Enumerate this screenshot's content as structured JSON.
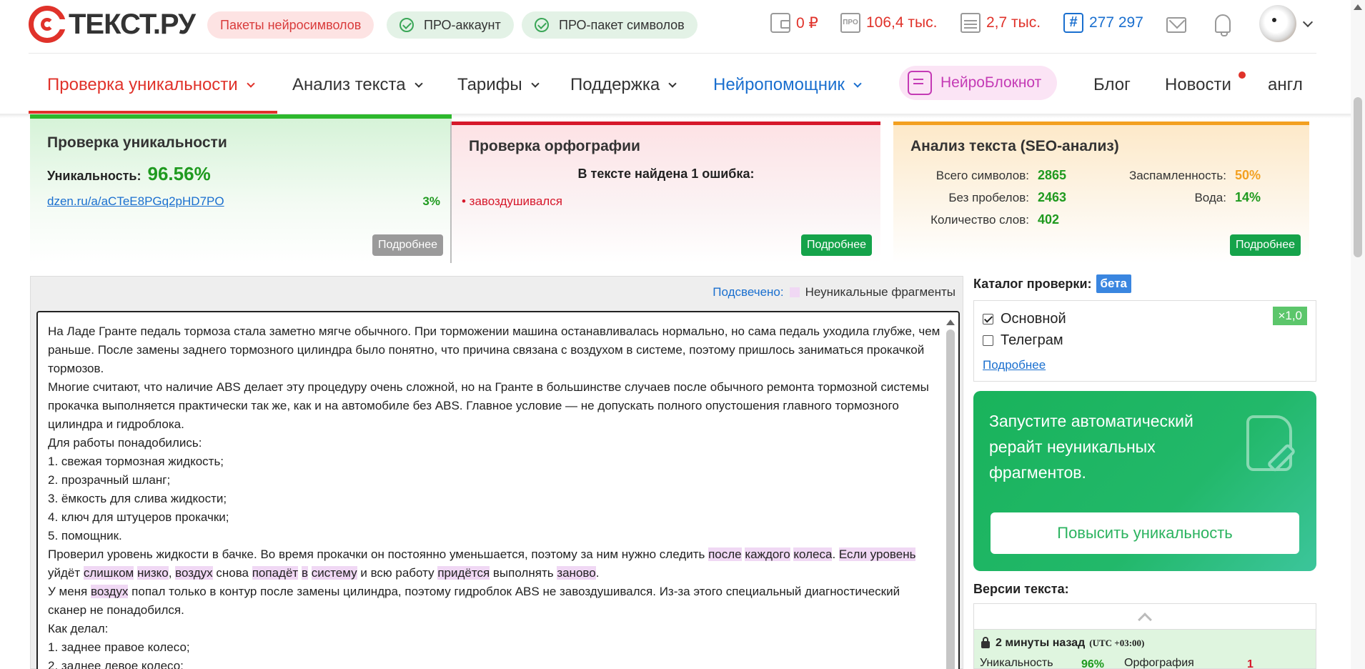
{
  "header": {
    "logo_text": "ТЕКСТ.РУ",
    "pills": {
      "neuro_packs": "Пакеты нейросимволов",
      "pro_account": "ПРО-аккаунт",
      "pro_package": "ПРО-пакет символов"
    },
    "stats": {
      "balance": "0 ₽",
      "pro_chars": "106,4 тыс.",
      "calendar_chars": "2,7 тыс.",
      "hash_count": "277 297"
    },
    "pro_icon_text": "ПРО",
    "hash_icon_text": "#",
    "icons": [
      "wallet-icon",
      "pro-icon",
      "calendar-icon",
      "hash-icon",
      "mail-icon",
      "bell-icon",
      "avatar",
      "chevron-down-icon"
    ],
    "colors": {
      "accent": "#e0322a",
      "link": "#1a6fcf"
    }
  },
  "nav": {
    "items": {
      "uniqueness": "Проверка уникальности",
      "analysis": "Анализ текста",
      "tariffs": "Тарифы",
      "support": "Поддержка",
      "neuro_helper": "Нейропомощник",
      "neuro_notebook": "НейроБлокнот",
      "blog": "Блог",
      "news": "Новости",
      "lang": "англ"
    }
  },
  "cards": {
    "uniq": {
      "title": "Проверка уникальности",
      "label": "Уникальность:",
      "value": "96.56%",
      "source_link": "dzen.ru/a/aCTeE8PGq2pHD7PO",
      "source_pct": "3%",
      "more": "Подробнее",
      "color": "#2db82d"
    },
    "orth": {
      "title": "Проверка орфографии",
      "found": "В тексте найдена 1 ошибка:",
      "error": "• завоздушивался",
      "more": "Подробнее",
      "color": "#d6172a"
    },
    "seo": {
      "title": "Анализ текста (SEO-анализ)",
      "total_label": "Всего символов:",
      "total_value": "2865",
      "nospace_label": "Без пробелов:",
      "nospace_value": "2463",
      "words_label": "Количество слов:",
      "words_value": "402",
      "spam_label": "Заспамленность:",
      "spam_value": "50%",
      "water_label": "Вода:",
      "water_value": "14%",
      "more": "Подробнее",
      "color": "#f3a020"
    }
  },
  "editor": {
    "legend_label": "Подсвечено:",
    "legend_text": "Неуникальные фрагменты",
    "paragraphs": [
      "На Ладе Гранте педаль тормоза стала заметно мягче обычного. При торможении машина останавливалась нормально, но сама педаль уходила глубже, чем раньше. После замены заднего тормозного цилиндра было понятно, что причина связана с воздухом в системе, поэтому пришлось заниматься прокачкой тормозов.",
      "Многие считают, что наличие ABS делает эту процедуру очень сложной, но на Гранте в большинстве случаев после обычного ремонта тормозной системы прокачка выполняется практически так же, как и на автомобиле без ABS. Главное условие — не допускать полного опустошения главного тормозного цилиндра и гидроблока.",
      "Для работы понадобились:",
      "1. свежая тормозная жидкость;",
      "2. прозрачный шланг;",
      "3. ёмкость для слива жидкости;",
      "4. ключ для штуцеров прокачки;",
      "5. помощник."
    ],
    "p9": {
      "a": "Проверил уровень жидкости в бачке. Во время прокачки он постоянно уменьшается, поэтому за ним нужно следить ",
      "h1": "после",
      "h2": "каждого",
      "h3": "колеса",
      "b": ". ",
      "h4": "Если уровень",
      "c": " уйдёт ",
      "h5": "слишком",
      "h6": "низко",
      "d": ", ",
      "h7": "воздух",
      "e": " снова ",
      "h8": "попадёт",
      "h9": "в",
      "h10": "систему",
      "f": " и всю работу ",
      "h11": "придётся",
      "g": " выполнять ",
      "h12": "заново",
      "h": "."
    },
    "p10": {
      "a": "У меня ",
      "h1": "воздух",
      "b": " попал только в контур после замены цилиндра, поэтому гидроблок ABS не завоздушивался. Из-за этого специальный диагностический сканер не понадобился."
    },
    "tail": [
      "Как делал:",
      "1. заднее правое колесо;",
      "2. заднее левое колесо;"
    ],
    "highlight_color": "#f0d8f4"
  },
  "catalog": {
    "title": "Каталог проверки:",
    "beta": "бета",
    "main": "Основной",
    "telegram": "Телеграм",
    "multiplier": "×1,0",
    "more": "Подробнее"
  },
  "promo": {
    "text": "Запустите автоматический рерайт неуникальных фрагментов.",
    "button": "Повысить уникальность"
  },
  "versions": {
    "title": "Версии текста:",
    "time": "2 минуты назад",
    "tz": "(UTC +03:00)",
    "uniq_label": "Уникальность",
    "uniq_value": "96%",
    "orth_label": "Орфография",
    "orth_value": "1"
  }
}
